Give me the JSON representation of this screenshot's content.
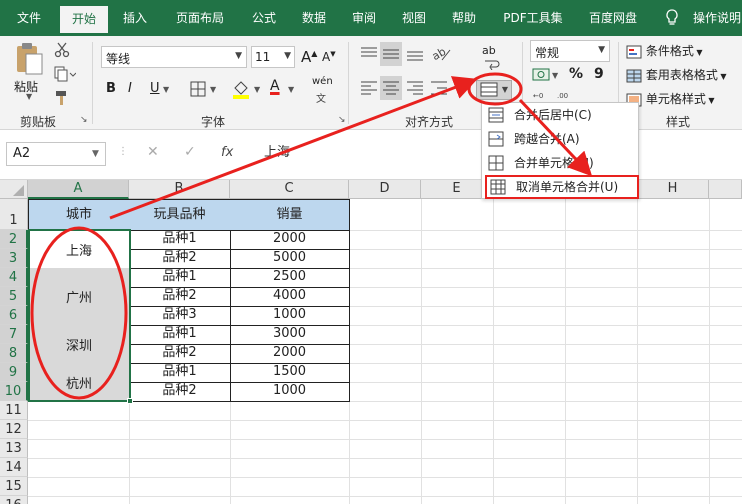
{
  "tabs": [
    "文件",
    "开始",
    "插入",
    "页面布局",
    "公式",
    "数据",
    "审阅",
    "视图",
    "帮助",
    "PDF工具集",
    "百度网盘",
    "操作说明"
  ],
  "active_tab": "开始",
  "ribbon": {
    "clipboard": {
      "paste_label": "粘贴",
      "group_label": "剪贴板"
    },
    "font": {
      "font_name": "等线",
      "font_size": "11",
      "bold": "B",
      "italic": "I",
      "underline": "U",
      "grow": "A",
      "shrink": "A",
      "font_color": "A",
      "pinyin": "wén",
      "group_label": "字体"
    },
    "align": {
      "group_label": "对齐方式",
      "wrap": "ab"
    },
    "number": {
      "format": "常规",
      "percent": "%",
      "comma": "9"
    },
    "styles": {
      "conditional": "条件格式",
      "table": "套用表格格式",
      "cell": "单元格样式",
      "group_label": "样式"
    }
  },
  "formula_bar": {
    "name_box": "A2",
    "fx": "fx",
    "content": "上海"
  },
  "columns": [
    "A",
    "B",
    "C",
    "D",
    "E",
    "F",
    "G",
    "H"
  ],
  "rows": [
    "1",
    "2",
    "3",
    "4",
    "5",
    "6",
    "7",
    "8",
    "9",
    "10",
    "11",
    "12",
    "13",
    "14",
    "15",
    "16"
  ],
  "table": {
    "headers": [
      "城市",
      "玩具品种",
      "销量"
    ],
    "cities": [
      "上海",
      "广州",
      "深圳",
      "杭州"
    ],
    "varieties": [
      "品种1",
      "品种2",
      "品种1",
      "品种2",
      "品种3",
      "品种1",
      "品种2",
      "品种1",
      "品种2"
    ],
    "sales": [
      "2000",
      "5000",
      "2500",
      "4000",
      "1000",
      "3000",
      "2000",
      "1500",
      "1000"
    ]
  },
  "merge_menu": {
    "items": [
      "合并后居中(C)",
      "跨越合并(A)",
      "合并单元格(M)",
      "取消单元格合并(U)"
    ]
  },
  "colors": {
    "accent": "#217346",
    "header_fill": "#bdd7ee",
    "merged_fill": "#d9d9d9",
    "annotation": "#e8211e"
  }
}
